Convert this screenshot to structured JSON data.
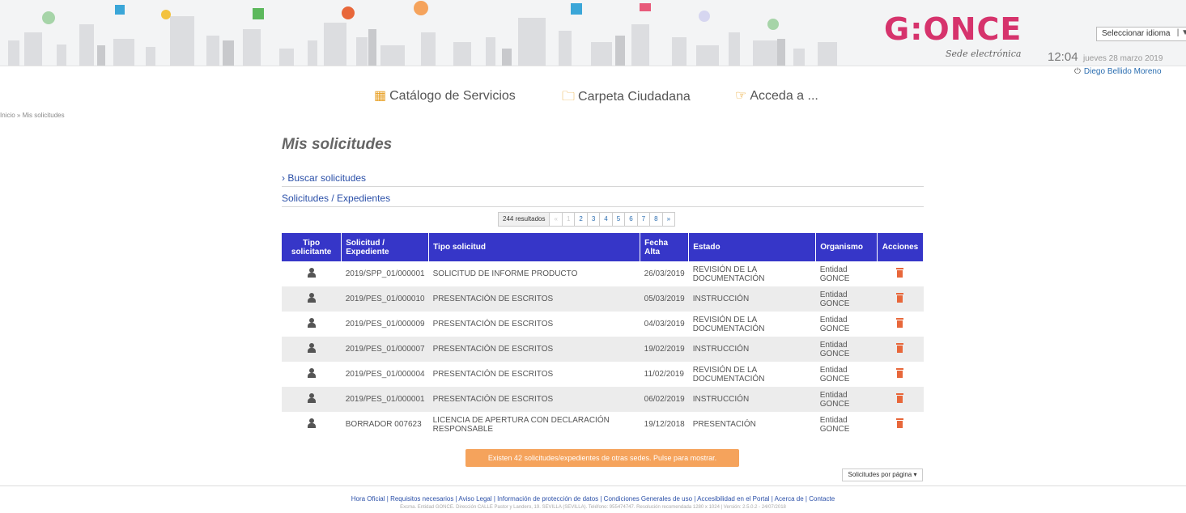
{
  "header": {
    "logo_text": "G:ONCE",
    "logo_subtitle": "Sede electrónica",
    "language_select": "Seleccionar idioma",
    "time": "12:04",
    "date": "jueves 28 marzo 2019",
    "user_name": "Diego Bellido Moreno"
  },
  "nav": {
    "items": [
      {
        "label": "Catálogo de Servicios",
        "icon": "grid-icon"
      },
      {
        "label": "Carpeta Ciudadana",
        "icon": "folder-icon"
      },
      {
        "label": "Acceda a ...",
        "icon": "pointing-hand-icon"
      }
    ]
  },
  "breadcrumb": "Inicio » Mis solicitudes",
  "page_title": "Mis solicitudes",
  "search_toggle": "Buscar solicitudes",
  "results_section": "Solicitudes / Expedientes",
  "pagination": {
    "count": "244 resultados",
    "first": "«",
    "current": "1",
    "pages": [
      "2",
      "3",
      "4",
      "5",
      "6",
      "7",
      "8"
    ],
    "next": "»"
  },
  "table": {
    "headers": {
      "type": "Tipo solicitante",
      "id": "Solicitud / Expediente",
      "request_type": "Tipo solicitud",
      "date": "Fecha Alta",
      "status": "Estado",
      "organism": "Organismo",
      "actions": "Acciones"
    },
    "rows": [
      {
        "id": "2019/SPP_01/000001",
        "request_type": "SOLICITUD DE INFORME PRODUCTO",
        "date": "26/03/2019",
        "status": "REVISIÓN DE LA DOCUMENTACIÓN",
        "organism": "Entidad GONCE"
      },
      {
        "id": "2019/PES_01/000010",
        "request_type": "PRESENTACIÓN DE ESCRITOS",
        "date": "05/03/2019",
        "status": "INSTRUCCIÓN",
        "organism": "Entidad GONCE"
      },
      {
        "id": "2019/PES_01/000009",
        "request_type": "PRESENTACIÓN DE ESCRITOS",
        "date": "04/03/2019",
        "status": "REVISIÓN DE LA DOCUMENTACIÓN",
        "organism": "Entidad GONCE"
      },
      {
        "id": "2019/PES_01/000007",
        "request_type": "PRESENTACIÓN DE ESCRITOS",
        "date": "19/02/2019",
        "status": "INSTRUCCIÓN",
        "organism": "Entidad GONCE"
      },
      {
        "id": "2019/PES_01/000004",
        "request_type": "PRESENTACIÓN DE ESCRITOS",
        "date": "11/02/2019",
        "status": "REVISIÓN DE LA DOCUMENTACIÓN",
        "organism": "Entidad GONCE"
      },
      {
        "id": "2019/PES_01/000001",
        "request_type": "PRESENTACIÓN DE ESCRITOS",
        "date": "06/02/2019",
        "status": "INSTRUCCIÓN",
        "organism": "Entidad GONCE"
      },
      {
        "id": "BORRADOR 007623",
        "request_type": "LICENCIA DE APERTURA CON DECLARACIÓN RESPONSABLE",
        "date": "19/12/2018",
        "status": "PRESENTACIÓN",
        "organism": "Entidad GONCE"
      }
    ]
  },
  "other_sites_button": "Existen 42 solicitudes/expedientes de otras sedes. Pulse para mostrar.",
  "per_page": "Solicitudes por página",
  "footer": {
    "links": [
      "Hora Oficial",
      "Requisitos necesarios",
      "Aviso Legal",
      "Información de protección de datos",
      "Condiciones Generales de uso",
      "Accesibilidad en el Portal",
      "Acerca de",
      "Contacte"
    ],
    "info": "Excma. Entidad GONCE. Dirección CALLE Pastor y Landero, 19. SEVILLA (SEVILLA). Teléfono: 955474747. Resolución recomendada 1280 x 1024 | Versión: 2.5.0.2 - 24/07/2018"
  },
  "colors": {
    "accent": "#d6336c",
    "table_header": "#3636c8",
    "link": "#2a4fa8",
    "action": "#e8673a",
    "other_sites_button": "#f5a35c"
  }
}
